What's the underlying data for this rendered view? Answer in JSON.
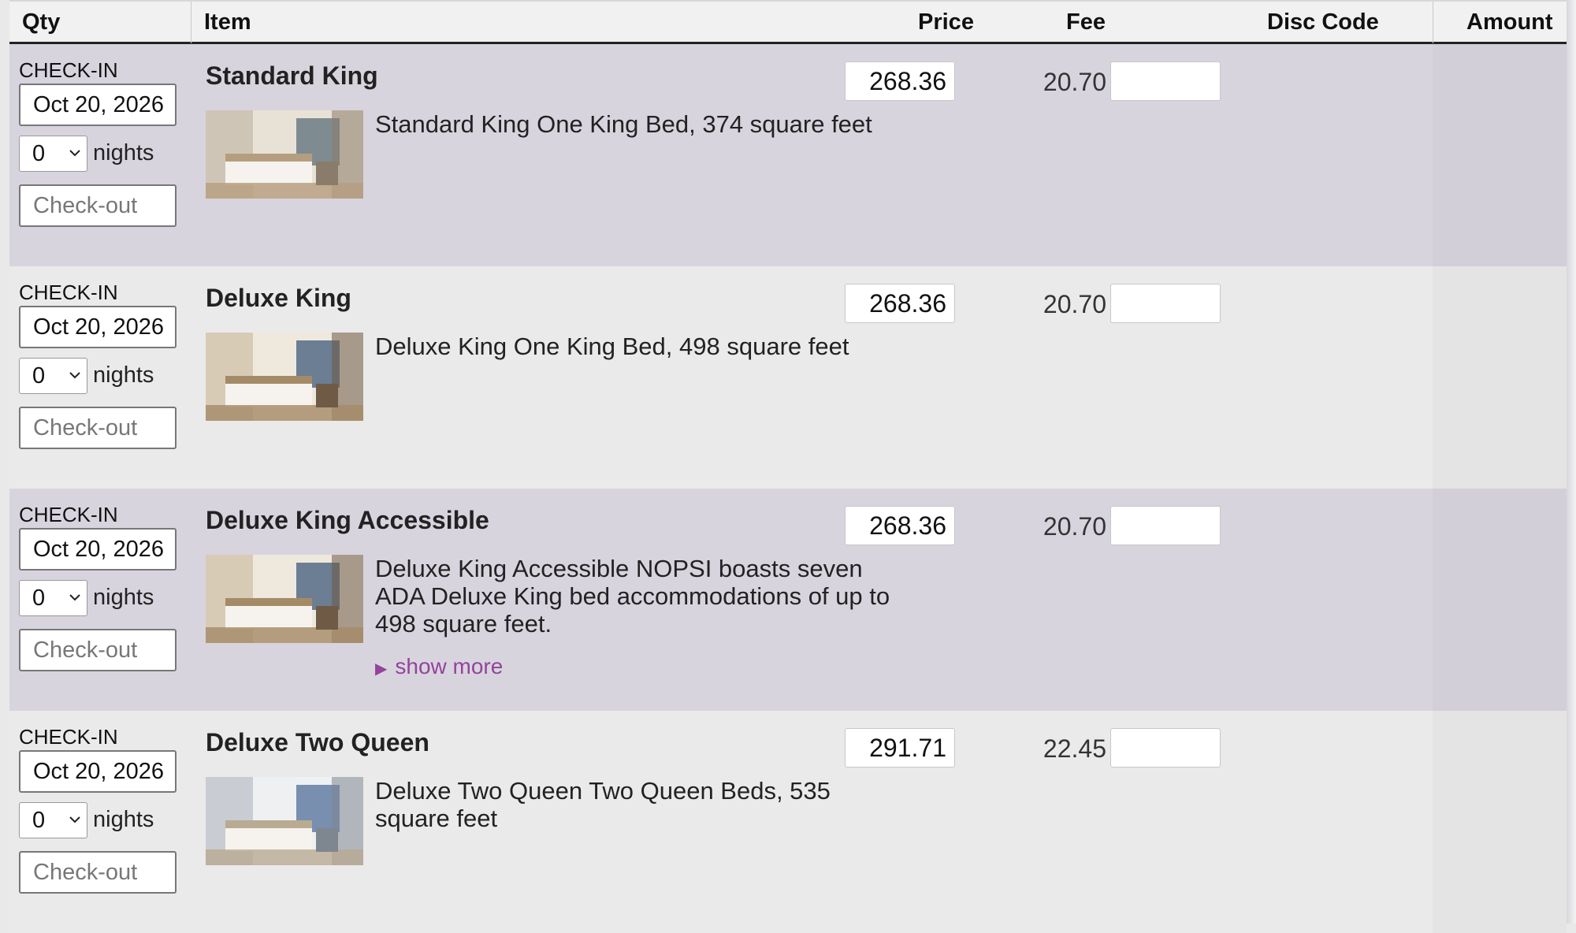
{
  "columns": {
    "qty": "Qty",
    "item": "Item",
    "price": "Price",
    "fee": "Fee",
    "disc_code": "Disc Code",
    "amount": "Amount"
  },
  "rooms": [
    {
      "checkin_label": "CHECK-IN",
      "checkin_date": "Oct 20, 2026",
      "nights_value": "0",
      "nights_label": "nights",
      "checkout_placeholder": "Check-out",
      "title": "Standard King",
      "description": "Standard King One King Bed, 374 square feet",
      "price": "268.36",
      "fee": "20.70",
      "disc_code": "",
      "amount": ""
    },
    {
      "checkin_label": "CHECK-IN",
      "checkin_date": "Oct 20, 2026",
      "nights_value": "0",
      "nights_label": "nights",
      "checkout_placeholder": "Check-out",
      "title": "Deluxe King",
      "description": "Deluxe King One King Bed, 498 square feet",
      "price": "268.36",
      "fee": "20.70",
      "disc_code": "",
      "amount": ""
    },
    {
      "checkin_label": "CHECK-IN",
      "checkin_date": "Oct 20, 2026",
      "nights_value": "0",
      "nights_label": "nights",
      "checkout_placeholder": "Check-out",
      "title": "Deluxe King Accessible",
      "description": "Deluxe King Accessible NOPSI boasts seven ADA Deluxe King bed accommodations of up to 498 square feet.",
      "show_more": "show more",
      "price": "268.36",
      "fee": "20.70",
      "disc_code": "",
      "amount": ""
    },
    {
      "checkin_label": "CHECK-IN",
      "checkin_date": "Oct 20, 2026",
      "nights_value": "0",
      "nights_label": "nights",
      "checkout_placeholder": "Check-out",
      "title": "Deluxe Two Queen",
      "description": "Deluxe Two Queen Two Queen Beds, 535 square feet",
      "price": "291.71",
      "fee": "22.45",
      "disc_code": "",
      "amount": ""
    }
  ],
  "colors": {
    "row_alt": "#d8d4de",
    "row_plain": "#eaeaeb",
    "link": "#93449b"
  },
  "icons": {
    "select_arrow": "chevron-down-icon",
    "expand": "triangle-right-icon"
  }
}
